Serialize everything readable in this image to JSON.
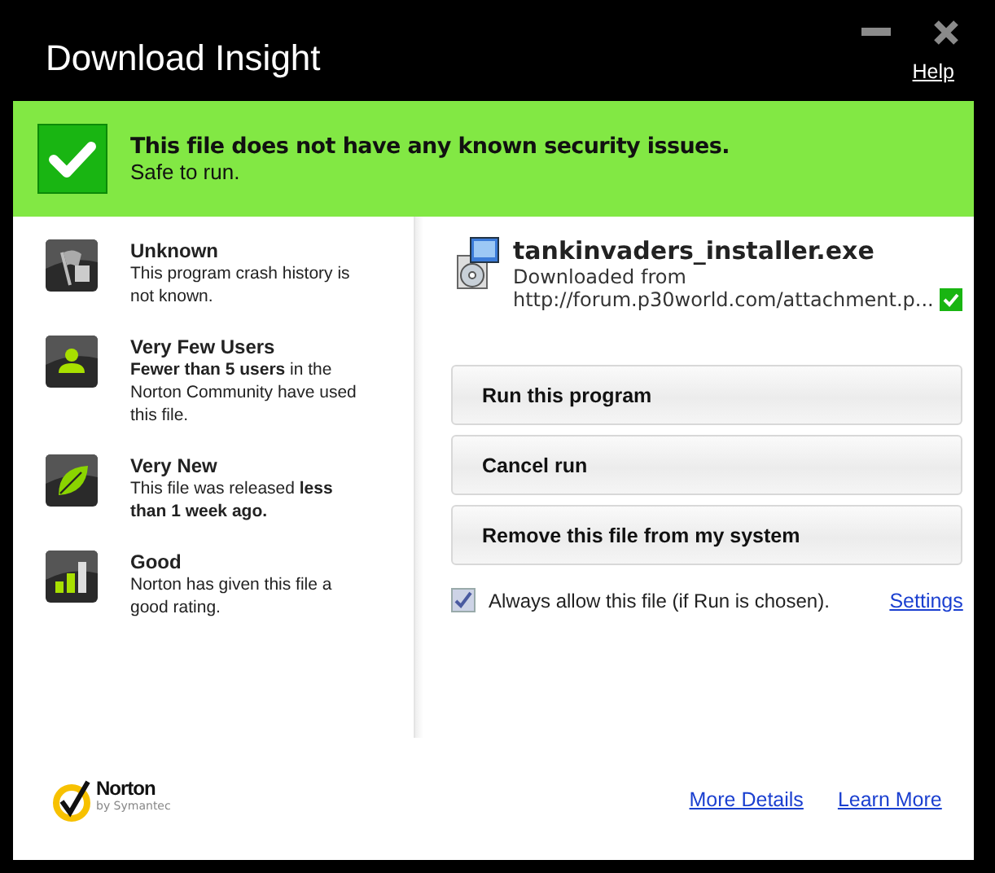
{
  "window": {
    "title": "Download Insight",
    "help_link": "Help"
  },
  "banner": {
    "safe": true,
    "headline": "This file does not have any known security issues.",
    "subline": "Safe to run."
  },
  "factors": [
    {
      "kind": "stability",
      "title": "Unknown",
      "description": "This program crash history is not known."
    },
    {
      "kind": "users",
      "title": "Very Few Users",
      "description": "**Fewer than 5 users** in the Norton Community have used this file."
    },
    {
      "kind": "age",
      "title": "Very New",
      "description": "This file was released **less than 1 week ago.**"
    },
    {
      "kind": "rating",
      "title": "Good",
      "description": "Norton has given this file a good rating."
    }
  ],
  "file": {
    "name": "tankinvaders_installer.exe",
    "source_label": "Downloaded from",
    "source_url": "http://forum.p30world.com/attachment.p...",
    "source_trusted": true
  },
  "actions": [
    "Run this program",
    "Cancel run",
    "Remove this file from my system"
  ],
  "always_allow": {
    "label": "Always allow this file (if Run is chosen).",
    "checked": true
  },
  "settings_link": "Settings",
  "logo": {
    "name": "Norton",
    "tagline": "by Symantec"
  },
  "footer_links": [
    "More Details",
    "Learn More"
  ]
}
